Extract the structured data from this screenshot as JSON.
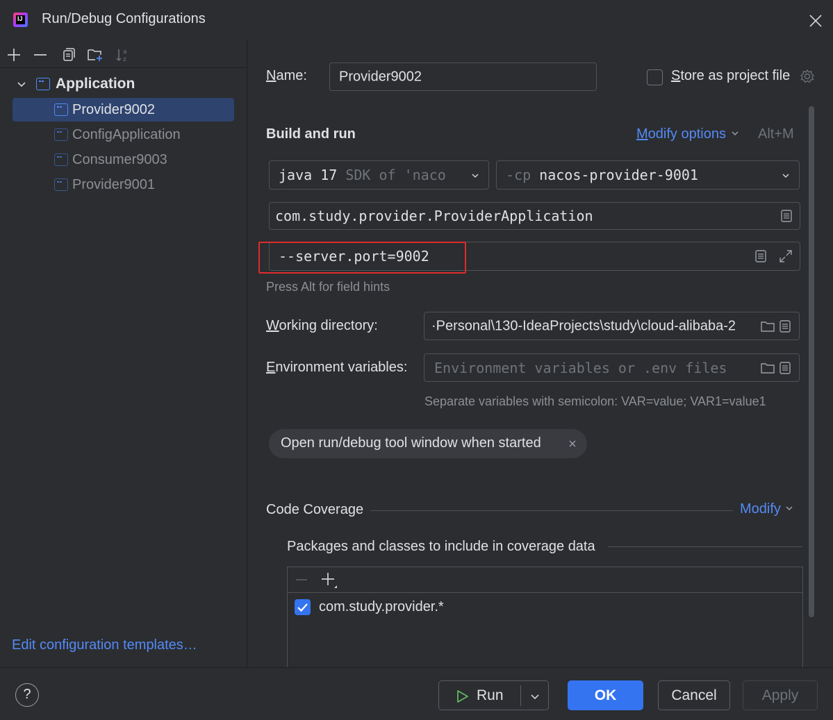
{
  "window": {
    "title": "Run/Debug Configurations",
    "logo_text": "IJ"
  },
  "tree": {
    "group_label": "Application",
    "items": [
      {
        "label": "Provider9002",
        "selected": true
      },
      {
        "label": "ConfigApplication",
        "selected": false
      },
      {
        "label": "Consumer9003",
        "selected": false
      },
      {
        "label": "Provider9001",
        "selected": false
      }
    ],
    "edit_templates": "Edit configuration templates…"
  },
  "form": {
    "name_label_first": "N",
    "name_label_rest": "ame:",
    "name_value": "Provider9002",
    "store_first": "S",
    "store_rest": "tore as project file",
    "store_checked": false,
    "build_run": "Build and run",
    "modify_first": "M",
    "modify_rest": "odify options",
    "modify_shortcut": "Alt+M",
    "sdk_main": "java 17",
    "sdk_dim": "SDK of 'naco",
    "cp_dim": "-cp",
    "cp_value": "nacos-provider-9001",
    "main_class": "com.study.provider.ProviderApplication",
    "program_args": "--server.port=9002",
    "field_hint": "Press Alt for field hints",
    "wd_first": "W",
    "wd_rest": "orking directory:",
    "wd_value": "·Personal\\130-IdeaProjects\\study\\cloud-alibaba-2",
    "env_first": "E",
    "env_rest": "nvironment variables:",
    "env_placeholder": "Environment variables or .env files",
    "env_hint": "Separate variables with semicolon: VAR=value; VAR1=value1",
    "chip_label": "Open run/debug tool window when started",
    "code_coverage": "Code Coverage",
    "cc_modify": "Modify",
    "packages_label": "Packages and classes to include in coverage data",
    "package_item": "com.study.provider.*",
    "package_checked": true
  },
  "footer": {
    "help": "?",
    "run": "Run",
    "ok": "OK",
    "cancel": "Cancel",
    "apply": "Apply"
  },
  "colors": {
    "accent": "#3574f0",
    "link": "#548af7",
    "highlight_box": "#e02b2b",
    "selection": "#2e436e"
  }
}
